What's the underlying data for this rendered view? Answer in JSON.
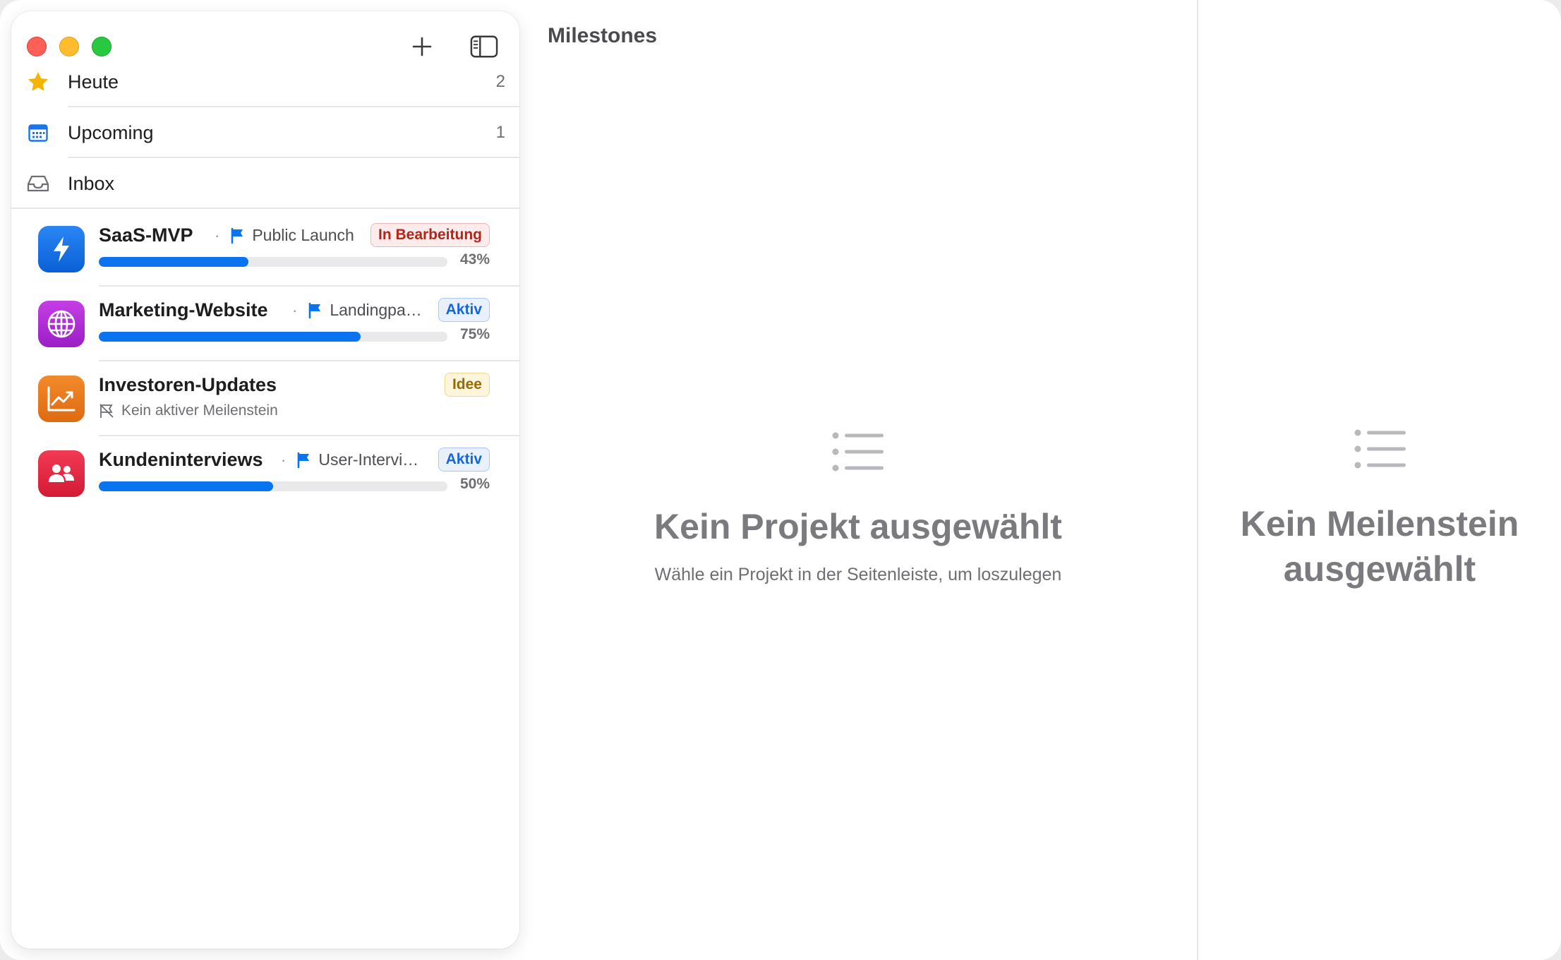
{
  "app": {
    "title": "Milestones"
  },
  "sidebar": {
    "nav": [
      {
        "label": "Heute",
        "count": "2",
        "icon": "star-icon"
      },
      {
        "label": "Upcoming",
        "count": "1",
        "icon": "calendar-icon"
      },
      {
        "label": "Inbox",
        "count": "",
        "icon": "inbox-icon"
      }
    ],
    "projects": [
      {
        "name": "SaaS-MVP",
        "milestone": "Public Launch",
        "status": "In Bearbeitung",
        "progress_label": "43%",
        "progress": 0.43,
        "icon": "bolt-icon",
        "color": "#1a73e8"
      },
      {
        "name": "Marketing-Website",
        "milestone": "Landingpa…",
        "status": "Aktiv",
        "progress_label": "75%",
        "progress": 0.75,
        "icon": "globe-icon",
        "color": "#b02ad8"
      },
      {
        "name": "Investoren-Updates",
        "milestone": "Kein aktiver Meilenstein",
        "status": "Idee",
        "icon": "chart-line-icon",
        "color": "#ec7a1c"
      },
      {
        "name": "Kundeninterviews",
        "milestone": "User-Intervi…",
        "status": "Aktiv",
        "progress_label": "50%",
        "progress": 0.5,
        "icon": "people-icon",
        "color": "#e8243f"
      }
    ]
  },
  "main": {
    "empty_title": "Kein Projekt ausgewählt",
    "empty_subtitle": "Wähle ein Projekt in der Seitenleiste, um loszulegen"
  },
  "detail": {
    "empty_title_line1": "Kein Meilenstein",
    "empty_title_line2": "ausgewählt"
  },
  "colors": {
    "accent": "#0a74f0",
    "star": "#f5b400"
  }
}
